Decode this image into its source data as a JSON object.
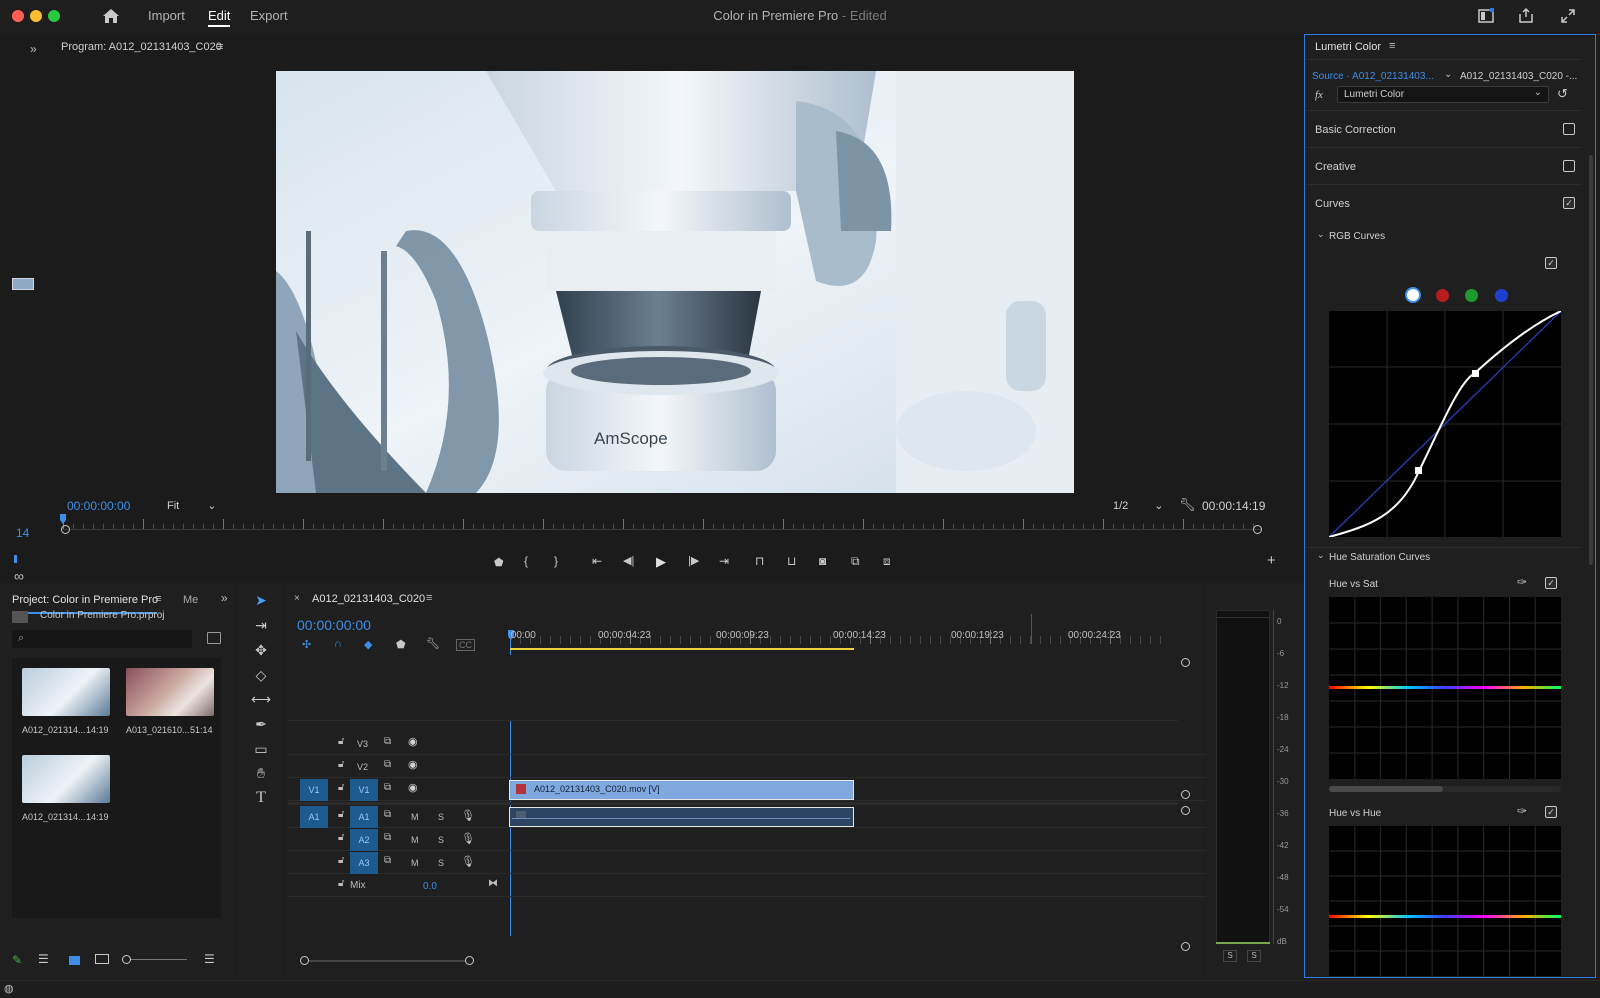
{
  "menu": {
    "home_icon": "home-icon",
    "items": [
      "Import",
      "Edit",
      "Export"
    ],
    "active": "Edit"
  },
  "window": {
    "title": "Color in Premiere Pro",
    "status": "- Edited"
  },
  "program_monitor": {
    "tab_label": "Program: A012_02131403_C020",
    "frame_number": "14",
    "timecode_current": "00:00:00:00",
    "fit": "Fit",
    "resolution": "1/2",
    "timecode_duration": "00:00:14:19",
    "video_brand_text": "AmScope"
  },
  "project_panel": {
    "tab_label": "Project: Color in Premiere Pro",
    "tab2_label": "Me",
    "file_name": "Color in Premiere Pro.prproj",
    "items": [
      {
        "name": "A012_021314...",
        "duration": "14:19"
      },
      {
        "name": "A013_021610...",
        "duration": "51:14"
      },
      {
        "name": "A012_021314...",
        "duration": "14:19"
      }
    ]
  },
  "timeline": {
    "tab_label": "A012_02131403_C020",
    "timecode": "00:00:00:00",
    "ruler": [
      ":00:00",
      "00:00:04:23",
      "00:00:09:23",
      "00:00:14:23",
      "00:00:19:23",
      "00:00:24:23"
    ],
    "video_tracks": [
      "V3",
      "V2",
      "V1"
    ],
    "audio_tracks": [
      "A1",
      "A2",
      "A3"
    ],
    "source_v": "V1",
    "source_a": "A1",
    "mute": "M",
    "solo": "S",
    "mix_label": "Mix",
    "mix_value": "0.0",
    "clip_video": "A012_02131403_C020.mov [V]"
  },
  "meters": {
    "scale": [
      "0",
      "-6",
      "-12",
      "-18",
      "-24",
      "-30",
      "-36",
      "-42",
      "-48",
      "-54",
      "dB"
    ],
    "solo_labels": [
      "S",
      "S"
    ]
  },
  "lumetri": {
    "panel_title": "Lumetri Color",
    "source": "Source · A012_02131403...",
    "target": "A012_02131403_C020 -...",
    "fx_label": "fx",
    "effect": "Lumetri Color",
    "sections": [
      {
        "label": "Basic Correction",
        "checked": false
      },
      {
        "label": "Creative",
        "checked": false
      },
      {
        "label": "Curves",
        "checked": true
      }
    ],
    "rgb_curves_label": "RGB Curves",
    "hue_sat_label": "Hue Saturation Curves",
    "hue_vs_sat_label": "Hue vs Sat",
    "hue_vs_hue_label": "Hue vs Hue",
    "channel_colors": [
      "#ffffff",
      "#b81d1d",
      "#1e9a2e",
      "#1e3fd0"
    ]
  },
  "colors": {
    "accent": "#3d8ee8",
    "panel_border": "#2d7be0",
    "clip": "#7fa8de",
    "playhead_in": "#e8d33c"
  }
}
